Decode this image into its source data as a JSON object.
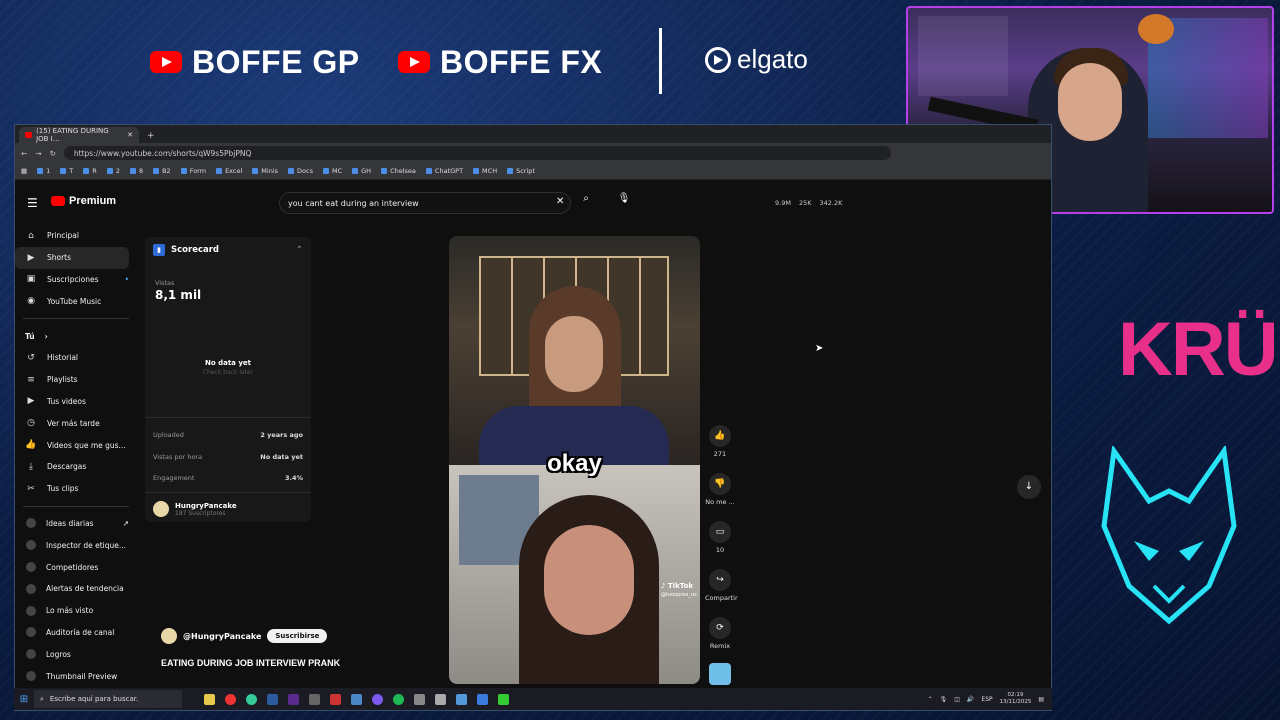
{
  "overlay": {
    "brands": [
      "BOFFE GP",
      "BOFFE FX"
    ],
    "sponsor": "elgato",
    "team_logo": "KRÜ"
  },
  "browser": {
    "tab_title": "(15) EATING DURING JOB I…",
    "url": "https://www.youtube.com/shorts/qW9s5PbjPNQ",
    "bookmarks": [
      "1",
      "T",
      "R",
      "2",
      "8",
      "B2",
      "Form",
      "Excel",
      "Minis",
      "Docs",
      "MC",
      "GH",
      "Chelsea",
      "ChatGPT",
      "MCH",
      "Script"
    ]
  },
  "youtube": {
    "logo": "Premium",
    "search_value": "you cant eat during an interview",
    "stats": [
      "9.9M",
      "25K",
      "342.2K"
    ],
    "sidebar_main": [
      {
        "label": "Principal",
        "icon": "home-icon"
      },
      {
        "label": "Shorts",
        "icon": "shorts-icon"
      },
      {
        "label": "Suscripciones",
        "icon": "subscriptions-icon"
      },
      {
        "label": "YouTube Music",
        "icon": "music-icon"
      }
    ],
    "sidebar_you_header": "Tú",
    "sidebar_you": [
      {
        "label": "Historial",
        "icon": "history-icon"
      },
      {
        "label": "Playlists",
        "icon": "playlist-icon"
      },
      {
        "label": "Tus videos",
        "icon": "video-icon"
      },
      {
        "label": "Ver más tarde",
        "icon": "clock-icon"
      },
      {
        "label": "Videos que me gus...",
        "icon": "like-icon"
      },
      {
        "label": "Descargas",
        "icon": "download-icon"
      },
      {
        "label": "Tus clips",
        "icon": "scissors-icon"
      }
    ],
    "sidebar_ext": [
      "Ideas diarias",
      "Inspector de etique...",
      "Competidores",
      "Alertas de tendencia",
      "Lo más visto",
      "Auditoría de canal",
      "Logros",
      "Thumbnail Preview"
    ],
    "scorecard": {
      "title": "Scorecard",
      "views_label": "Vistas",
      "views": "8,1 mil",
      "no_data": "No data yet",
      "check_back": "Check back later",
      "rows": [
        {
          "label": "Uploaded",
          "value": "2 years ago"
        },
        {
          "label": "Vistas por hora",
          "value": "No data yet"
        },
        {
          "label": "Engagement",
          "value": "3.4%"
        }
      ],
      "channel_name": "HungryPancake",
      "channel_subs": "187 Suscriptores"
    },
    "short": {
      "caption": "okay",
      "watermark": "TikTok",
      "watermark_handle": "@tooopree_us",
      "channel": "@HungryPancake",
      "subscribe": "Suscribirse",
      "title": "EATING DURING JOB INTERVIEW PRANK"
    },
    "actions": [
      {
        "icon": "thumbs-up-icon",
        "label": "271"
      },
      {
        "icon": "thumbs-down-icon",
        "label": "No me ..."
      },
      {
        "icon": "comment-icon",
        "label": "10"
      },
      {
        "icon": "share-icon",
        "label": "Compartir"
      },
      {
        "icon": "remix-icon",
        "label": "Remix"
      }
    ]
  },
  "taskbar": {
    "search_placeholder": "Escribe aquí para buscar.",
    "lang": "ESP",
    "time": "02:19",
    "date": "13/11/2025"
  }
}
